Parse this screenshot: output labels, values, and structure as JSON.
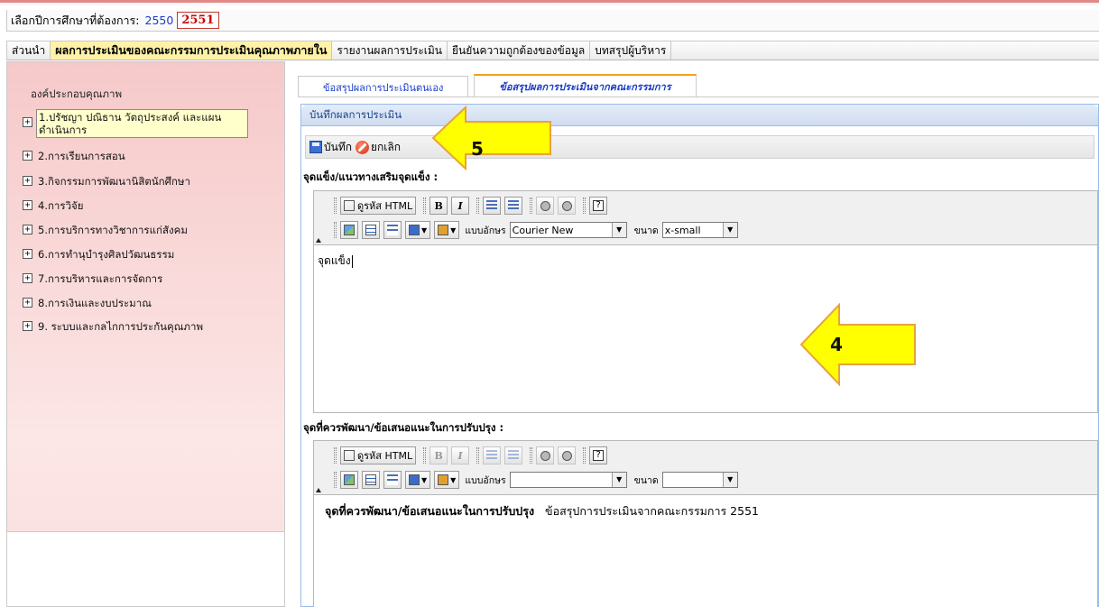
{
  "year_selector": {
    "label": "เลือกปีการศึกษาที่ต้องการ:",
    "year_a": "2550",
    "year_b": "2551"
  },
  "main_menu": [
    {
      "label": "ส่วนนำ",
      "active": false
    },
    {
      "label": "ผลการประเมินของคณะกรรมการประเมินคุณภาพภายใน",
      "active": true
    },
    {
      "label": "รายงานผลการประเมิน",
      "active": false
    },
    {
      "label": "ยืนยันความถูกต้องของข้อมูล",
      "active": false
    },
    {
      "label": "บทสรุปผู้บริหาร",
      "active": false
    }
  ],
  "sidebar": {
    "header": "องค์ประกอบคุณภาพ",
    "items": [
      "1.ปรัชญา ปณิธาน วัตถุประสงค์ และแผนดำเนินการ",
      "2.การเรียนการสอน",
      "3.กิจกรรมการพัฒนานิสิตนักศึกษา",
      "4.การวิจัย",
      "5.การบริการทางวิชาการแก่สังคม",
      "6.การทำนุบำรุงศิลปวัฒนธรรม",
      "7.การบริหารและการจัดการ",
      "8.การเงินและงบประมาณ",
      "9. ระบบและกลไกการประกันคุณภาพ"
    ]
  },
  "tabs": [
    {
      "label": "ข้อสรุปผลการประเมินตนเอง",
      "active": false
    },
    {
      "label": "ข้อสรุปผลการประเมินจากคณะกรรมการ",
      "active": true
    }
  ],
  "panel": {
    "title": "บันทึกผลการประเมิน",
    "save_label": "บันทึก",
    "cancel_label": "ยกเลิก"
  },
  "editor_tools": {
    "html_label": "ดูรหัส HTML",
    "bold": "B",
    "italic": "I",
    "help": "?",
    "font_label": "แบบอักษร",
    "size_label": "ขนาด"
  },
  "editor1": {
    "label": "จุดแข็ง/แนวทางเสริมจุดแข็ง :",
    "font_value": "Courier New",
    "size_value": "x-small",
    "content": "จุดแข็ง"
  },
  "editor2": {
    "label": "จุดที่ควรพัฒนา/ข้อเสนอแนะในการปรับปรุง :",
    "font_value": "",
    "size_value": "",
    "content_bold": "จุดที่ควรพัฒนา/ข้อเสนอแนะในการปรับปรุง",
    "content_rest": "ข้อสรุปการประเมินจากคณะกรรมการ 2551"
  },
  "callouts": {
    "a": "5",
    "b": "4"
  },
  "colors": {
    "callout_fill": "#ffff00",
    "callout_stroke": "#e8a33a",
    "active_menu": "#fff2a8"
  }
}
